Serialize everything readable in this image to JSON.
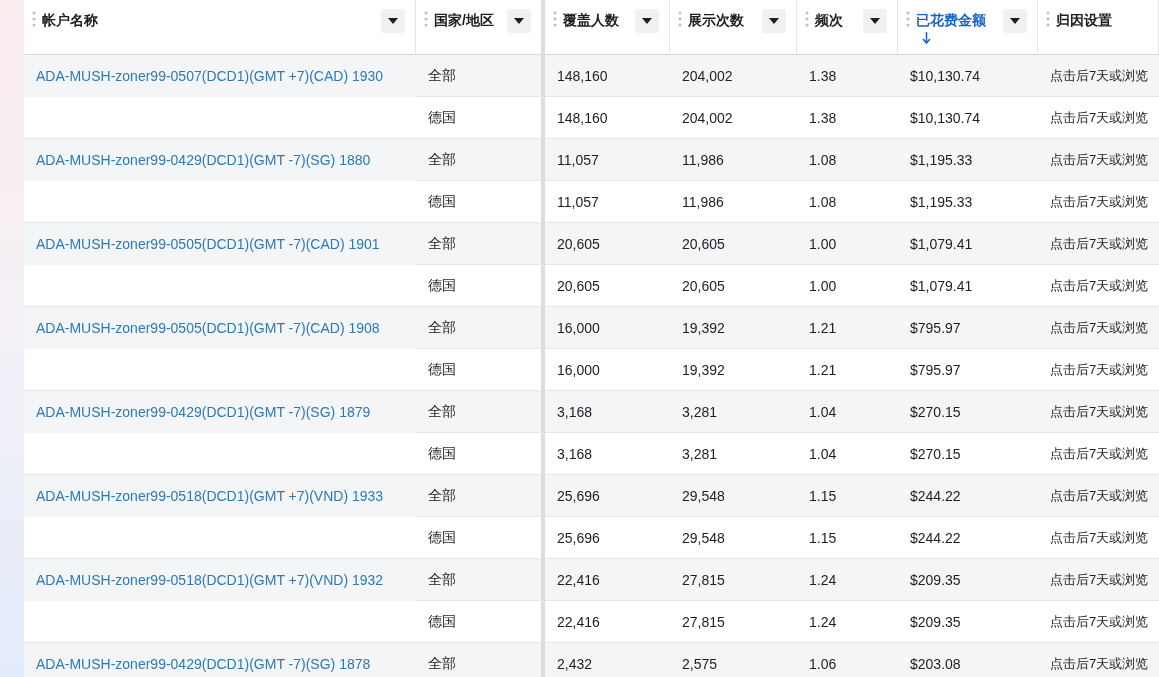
{
  "columns": [
    {
      "label": "帐户名称",
      "sorted": false,
      "menu": true
    },
    {
      "label": "国家/地区",
      "sorted": false,
      "menu": true
    },
    {
      "label": "覆盖人数",
      "sorted": false,
      "menu": true
    },
    {
      "label": "展示次数",
      "sorted": false,
      "menu": true
    },
    {
      "label": "频次",
      "sorted": false,
      "menu": true
    },
    {
      "label": "已花费金额",
      "sorted": true,
      "menu": true
    },
    {
      "label": "归因设置",
      "sorted": false,
      "menu": false
    }
  ],
  "groups": [
    {
      "account": "ADA-MUSH-zoner99-0507(DCD1)(GMT +7)(CAD) 1930",
      "rows": [
        [
          "全部",
          "148,160",
          "204,002",
          "1.38",
          "$10,130.74",
          "点击后7天或浏览"
        ],
        [
          "德国",
          "148,160",
          "204,002",
          "1.38",
          "$10,130.74",
          "点击后7天或浏览"
        ]
      ]
    },
    {
      "account": "ADA-MUSH-zoner99-0429(DCD1)(GMT -7)(SG) 1880",
      "rows": [
        [
          "全部",
          "11,057",
          "11,986",
          "1.08",
          "$1,195.33",
          "点击后7天或浏览"
        ],
        [
          "德国",
          "11,057",
          "11,986",
          "1.08",
          "$1,195.33",
          "点击后7天或浏览"
        ]
      ]
    },
    {
      "account": "ADA-MUSH-zoner99-0505(DCD1)(GMT -7)(CAD) 1901",
      "rows": [
        [
          "全部",
          "20,605",
          "20,605",
          "1.00",
          "$1,079.41",
          "点击后7天或浏览"
        ],
        [
          "德国",
          "20,605",
          "20,605",
          "1.00",
          "$1,079.41",
          "点击后7天或浏览"
        ]
      ]
    },
    {
      "account": "ADA-MUSH-zoner99-0505(DCD1)(GMT -7)(CAD) 1908",
      "rows": [
        [
          "全部",
          "16,000",
          "19,392",
          "1.21",
          "$795.97",
          "点击后7天或浏览"
        ],
        [
          "德国",
          "16,000",
          "19,392",
          "1.21",
          "$795.97",
          "点击后7天或浏览"
        ]
      ]
    },
    {
      "account": "ADA-MUSH-zoner99-0429(DCD1)(GMT -7)(SG) 1879",
      "rows": [
        [
          "全部",
          "3,168",
          "3,281",
          "1.04",
          "$270.15",
          "点击后7天或浏览"
        ],
        [
          "德国",
          "3,168",
          "3,281",
          "1.04",
          "$270.15",
          "点击后7天或浏览"
        ]
      ]
    },
    {
      "account": "ADA-MUSH-zoner99-0518(DCD1)(GMT +7)(VND) 1933",
      "rows": [
        [
          "全部",
          "25,696",
          "29,548",
          "1.15",
          "$244.22",
          "点击后7天或浏览"
        ],
        [
          "德国",
          "25,696",
          "29,548",
          "1.15",
          "$244.22",
          "点击后7天或浏览"
        ]
      ]
    },
    {
      "account": "ADA-MUSH-zoner99-0518(DCD1)(GMT +7)(VND) 1932",
      "rows": [
        [
          "全部",
          "22,416",
          "27,815",
          "1.24",
          "$209.35",
          "点击后7天或浏览"
        ],
        [
          "德国",
          "22,416",
          "27,815",
          "1.24",
          "$209.35",
          "点击后7天或浏览"
        ]
      ]
    },
    {
      "account": "ADA-MUSH-zoner99-0429(DCD1)(GMT -7)(SG) 1878",
      "rows": [
        [
          "全部",
          "2,432",
          "2,575",
          "1.06",
          "$203.08",
          "点击后7天或浏览"
        ]
      ]
    }
  ]
}
